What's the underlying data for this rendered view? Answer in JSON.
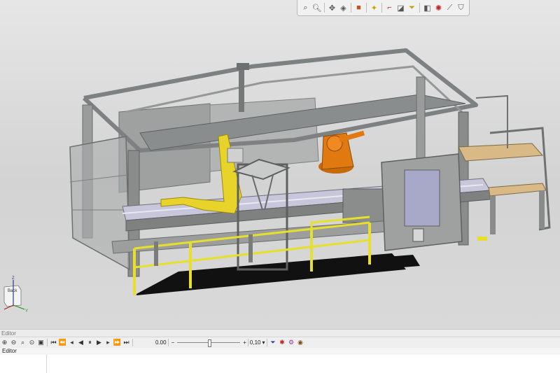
{
  "colors": {
    "frame_gray": "#8f9191",
    "robot_yellow": "#e8d32a",
    "robot_orange": "#e07a10",
    "railing_yellow": "#e6df2c",
    "floor_black": "#111111",
    "cabinet_blue": "#a8a9c8"
  },
  "view_toolbar": {
    "icons": [
      "zoom-fit-icon",
      "zoom-icon",
      "rotate-icon",
      "view-cube-icon",
      "box-icon",
      "light-icon",
      "axis-icon",
      "render-mode-icon",
      "filter-icon",
      "section-icon",
      "snap-icon",
      "measure-icon",
      "paint-icon"
    ]
  },
  "triad": {
    "z": "Z",
    "y": "Y",
    "x": "X",
    "face": "Back"
  },
  "status_bar": {
    "label": "Editor"
  },
  "editor_toolbar": {
    "time_value": "0.00",
    "minus": "−",
    "plus": "+",
    "speed_value": "0,10",
    "speed_dropdown": "▾"
  },
  "editor_label_bar": {
    "label": "Editor"
  }
}
